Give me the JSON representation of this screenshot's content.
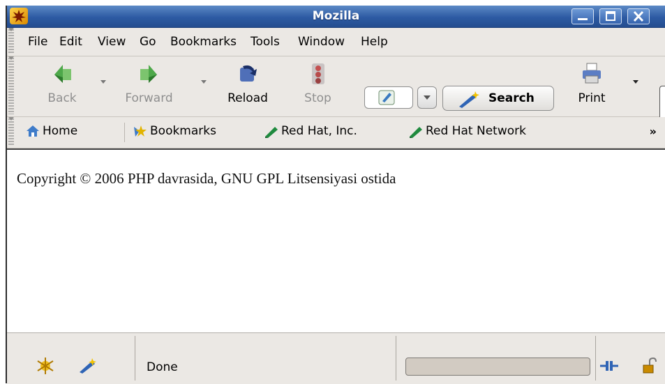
{
  "window": {
    "title": "Mozilla"
  },
  "menu": {
    "items": [
      "File",
      "Edit",
      "View",
      "Go",
      "Bookmarks",
      "Tools",
      "Window",
      "Help"
    ]
  },
  "navigation": {
    "back": "Back",
    "forward": "Forward",
    "reload": "Reload",
    "stop": "Stop",
    "search": "Search",
    "print": "Print"
  },
  "personal_toolbar": {
    "home": "Home",
    "bookmarks": "Bookmarks",
    "link1": "Red Hat, Inc.",
    "link2": "Red Hat Network",
    "more": "»"
  },
  "content": {
    "text": "Copyright © 2006 PHP davrasida, GNU GPL Litsensiyasi ostida"
  },
  "status": {
    "text": "Done"
  },
  "colors": {
    "titlebar": "#2d5aa3",
    "chrome": "#ebe8e4",
    "disabled_text": "#8f8f8f"
  }
}
